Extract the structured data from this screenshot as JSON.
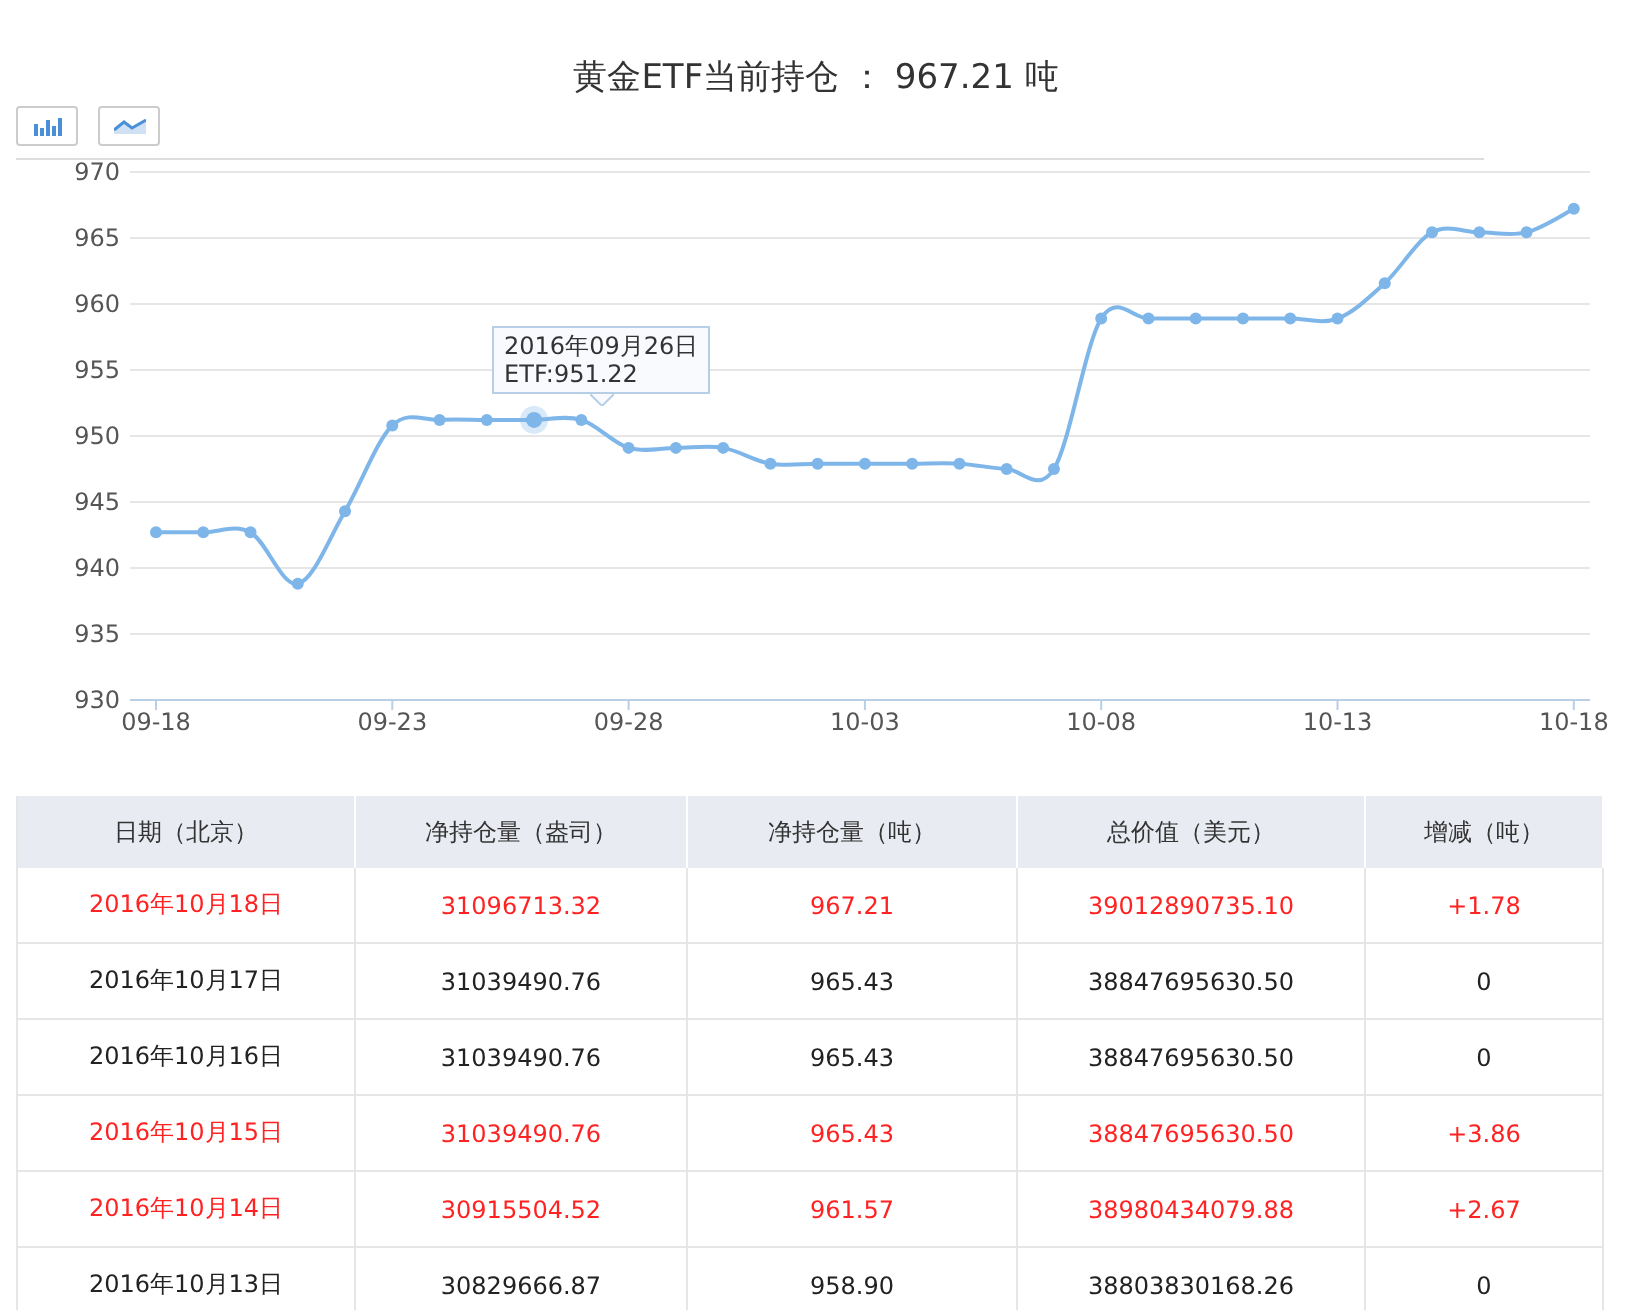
{
  "title": "黄金ETF当前持仓 ： 967.21 吨",
  "chart": {
    "chart_data": {
      "type": "line",
      "grid": true,
      "categories": [
        "09-18",
        null,
        null,
        null,
        null,
        "09-23",
        null,
        null,
        null,
        null,
        "09-28",
        null,
        null,
        null,
        null,
        "10-03",
        null,
        null,
        null,
        null,
        "10-08",
        null,
        null,
        null,
        null,
        "10-13",
        null,
        null,
        null,
        null,
        "10-18"
      ],
      "series": [
        {
          "name": "ETF",
          "color": "#7eb6ea",
          "marker": "circle",
          "values": [
            942.7,
            942.7,
            942.7,
            938.8,
            944.3,
            950.8,
            951.22,
            951.22,
            951.22,
            951.22,
            949.1,
            949.1,
            949.1,
            947.9,
            947.9,
            947.9,
            947.9,
            947.9,
            947.5,
            947.5,
            958.9,
            958.9,
            958.9,
            958.9,
            958.9,
            958.9,
            961.57,
            965.43,
            965.43,
            965.43,
            967.21
          ]
        }
      ],
      "ylim": [
        930,
        970
      ],
      "yticks": [
        930,
        935,
        940,
        945,
        950,
        955,
        960,
        965,
        970
      ]
    },
    "tooltip": {
      "date": "2016年09月26日",
      "text": ":951.22"
    }
  },
  "table": {
    "columns": [
      "日期（北京）",
      "净持仓量（盎司）",
      "净持仓量（吨）",
      "总价值（美元）",
      "增减（吨）"
    ],
    "rows": [
      {
        "rising": true,
        "cells": [
          "2016年10月18日",
          "31096713.32",
          "967.21",
          "39012890735.10",
          "+1.78"
        ]
      },
      {
        "rising": false,
        "cells": [
          "2016年10月17日",
          "31039490.76",
          "965.43",
          "38847695630.50",
          "0"
        ]
      },
      {
        "rising": false,
        "cells": [
          "2016年10月16日",
          "31039490.76",
          "965.43",
          "38847695630.50",
          "0"
        ]
      },
      {
        "rising": true,
        "cells": [
          "2016年10月15日",
          "31039490.76",
          "965.43",
          "38847695630.50",
          "+3.86"
        ]
      },
      {
        "rising": true,
        "cells": [
          "2016年10月14日",
          "30915504.52",
          "961.57",
          "38980434079.88",
          "+2.67"
        ]
      },
      {
        "rising": false,
        "cells": [
          "2016年10月13日",
          "30829666.87",
          "958.90",
          "38803830168.26",
          "0"
        ]
      }
    ]
  }
}
